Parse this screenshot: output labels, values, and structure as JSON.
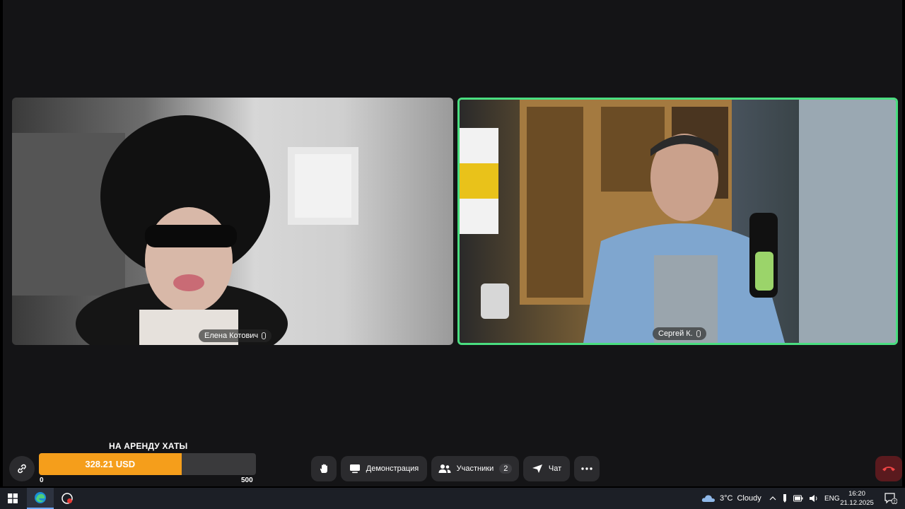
{
  "participants": [
    {
      "name": "Елена Котович",
      "speaking": false
    },
    {
      "name": "Сергей К.",
      "speaking": true
    }
  ],
  "fundraiser": {
    "title": "НА АРЕНДУ ХАТЫ",
    "amount_label": "328.21 USD",
    "amount": 328.21,
    "min_label": "0",
    "max_label": "500",
    "max": 500,
    "fill_color": "#f59e1b"
  },
  "controls": {
    "demo_label": "Демонстрация",
    "participants_label": "Участники",
    "participants_count": "2",
    "chat_label": "Чат"
  },
  "colors": {
    "active_speaker_border": "#4ade80",
    "hangup_bg": "#5a1a1e",
    "hangup_icon": "#ef4444"
  },
  "taskbar": {
    "weather_temp": "3°C",
    "weather_desc": "Cloudy",
    "lang": "ENG",
    "time": "16:20",
    "date": "21.12.2025",
    "notifications_count": "2"
  }
}
